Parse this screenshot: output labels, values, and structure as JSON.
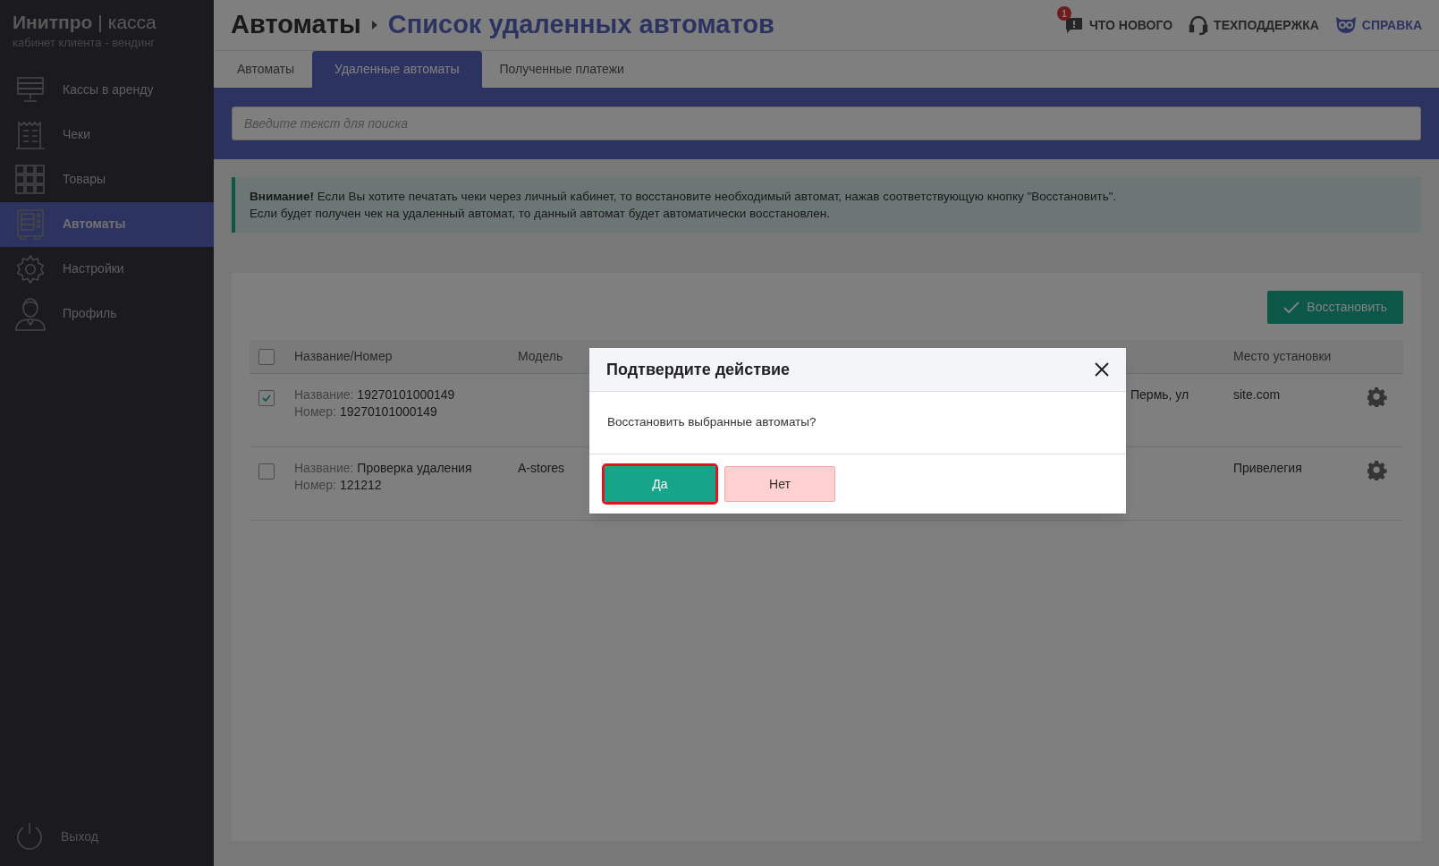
{
  "brand": {
    "name": "Инитпро",
    "separator": "|",
    "product": "касса",
    "subtitle": "кабинет клиента - вендинг"
  },
  "sidebar": {
    "items": [
      {
        "label": "Кассы в аренду",
        "kind": "server",
        "selected": false
      },
      {
        "label": "Чеки",
        "kind": "receipt",
        "selected": false
      },
      {
        "label": "Товары",
        "kind": "grid",
        "selected": false
      },
      {
        "label": "Автоматы",
        "kind": "machine",
        "selected": true
      },
      {
        "label": "Настройки",
        "kind": "gear",
        "selected": false
      },
      {
        "label": "Профиль",
        "kind": "person",
        "selected": false
      }
    ],
    "logout": "Выход"
  },
  "header": {
    "breadcrumb": "Автоматы",
    "title": "Список удаленных автоматов",
    "links": [
      {
        "label": "ЧТО НОВОГО",
        "kind": "news",
        "badge": "1"
      },
      {
        "label": "ТЕХПОДДЕРЖКА",
        "kind": "support"
      },
      {
        "label": "СПРАВКА",
        "kind": "help"
      }
    ]
  },
  "tabs": [
    {
      "label": "Автоматы",
      "selected": false
    },
    {
      "label": "Удаленные автоматы",
      "selected": true
    },
    {
      "label": "Полученные платежи",
      "selected": false
    }
  ],
  "search": {
    "placeholder": "Введите текст для поиска"
  },
  "alert": {
    "lines": [
      "**Внимание!** Если Вы хотите печатать чеки через личный кабинет, то восстановите необходимый автомат, нажав соответствующую кнопку \"Восстановить\".",
      "Если будет получен чек на удаленный автомат, то данный автомат будет автоматически восстановлен."
    ]
  },
  "restore_button": "Восстановить",
  "table": {
    "select_all": {
      "checked": false
    },
    "columns": [
      "Название/Номер",
      "Модель",
      "Место установки"
    ],
    "rows": [
      {
        "checked": true,
        "name_label": "Название:",
        "name": "19270101000149",
        "number_label": "Номер:",
        "number": "19270101000149",
        "column_4": "Пермь, ул",
        "place": "site.com"
      },
      {
        "checked": false,
        "name_label": "Название:",
        "name": "Проверка удаления",
        "number_label": "Номер:",
        "number": "121212",
        "model": "A-stores",
        "place": "Привелегия"
      }
    ]
  },
  "dialog": {
    "title": "Подтвердите действие",
    "message": "Восстановить выбранные автоматы?",
    "buttons": [
      {
        "label": "Да",
        "kind": "primary",
        "focused": true
      },
      {
        "label": "Нет",
        "kind": "secondary",
        "focused": false
      }
    ]
  }
}
